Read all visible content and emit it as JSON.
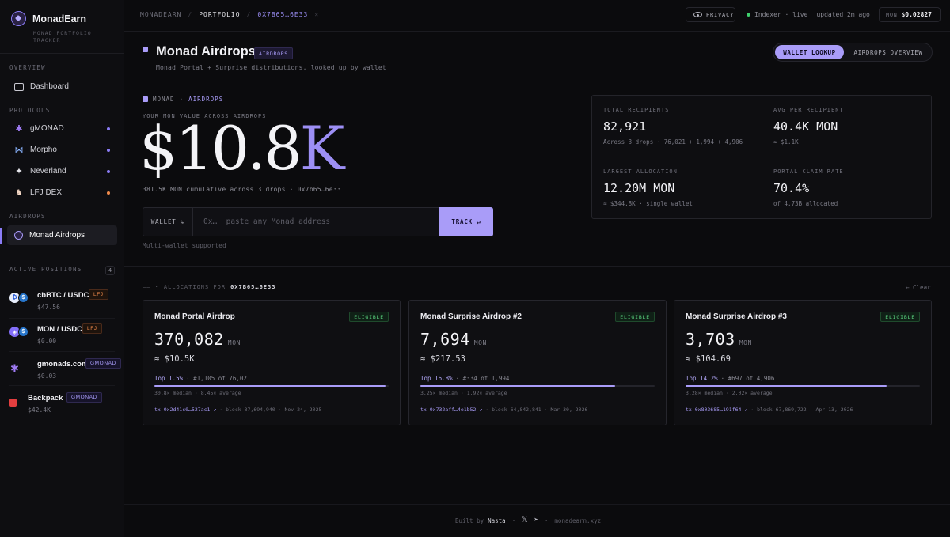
{
  "brand": {
    "name": "MonadEarn",
    "subtitle": "MONAD PORTFOLIO TRACKER"
  },
  "sidebar": {
    "sections": {
      "overview": "OVERVIEW",
      "protocols": "PROTOCOLS",
      "airdrops": "AIRDROPS",
      "active_positions": "ACTIVE POSITIONS"
    },
    "dashboard_label": "Dashboard",
    "protocols": [
      {
        "label": "gMONAD",
        "icon": "gmonad-icon",
        "dot_color": "#8b7cf6"
      },
      {
        "label": "Morpho",
        "icon": "morpho-icon",
        "dot_color": "#8b7cf6"
      },
      {
        "label": "Neverland",
        "icon": "sparkle-icon",
        "dot_color": "#8b7cf6"
      },
      {
        "label": "LFJ DEX",
        "icon": "lfj-icon",
        "dot_color": "#f08a4b"
      }
    ],
    "airdrops_label": "Monad Airdrops",
    "positions_count": "4",
    "positions": [
      {
        "name": "cbBTC / USDC",
        "value": "$47.56",
        "tag": "LFJ"
      },
      {
        "name": "MON / USDC",
        "value": "$0.00",
        "tag": "LFJ"
      },
      {
        "name": "gmonads.com",
        "value": "$0.03",
        "tag": "GMONAD"
      },
      {
        "name": "Backpack",
        "value": "$42.4K",
        "tag": "GMONAD"
      }
    ]
  },
  "topbar": {
    "crumbs": [
      "MONADEARN",
      "PORTFOLIO",
      "0X7B65…6E33"
    ],
    "close": "×",
    "privacy_label": "PRIVACY",
    "indexer_status": "Indexer · live",
    "updated": "updated 2m ago",
    "price_label": "MON",
    "price_value": "$0.02827"
  },
  "page": {
    "title": "Monad Airdrops",
    "badge": "AIRDROPS",
    "subtitle": "Monad Portal + Surprise distributions, looked up by wallet",
    "tabs": [
      "WALLET LOOKUP",
      "AIRDROPS OVERVIEW"
    ]
  },
  "hero": {
    "tag_a": "MONAD",
    "tag_sep": "·",
    "tag_b": "AIRDROPS",
    "label": "YOUR MON VALUE ACROSS AIRDROPS",
    "value_main": "$10.8",
    "value_suffix": "K",
    "sub": "381.5K MON cumulative across 3 drops · 0x7b65…6e33",
    "wallet_label": "WALLET ↳",
    "wallet_placeholder": "0x…  paste any Monad address",
    "track_label": "TRACK ↵",
    "note": "Multi-wallet supported"
  },
  "stats": [
    {
      "label": "TOTAL RECIPIENTS",
      "value": "82,921",
      "sub": "Across 3 drops · 76,021 + 1,994 + 4,906"
    },
    {
      "label": "AVG PER RECIPIENT",
      "value": "40.4K MON",
      "sub": "≈ $1.1K"
    },
    {
      "label": "LARGEST ALLOCATION",
      "value": "12.20M MON",
      "sub": "≈ $344.8K · single wallet"
    },
    {
      "label": "PORTAL CLAIM RATE",
      "value": "70.4%",
      "sub": "of 4.73B allocated"
    }
  ],
  "allocations": {
    "dash": "—— ·",
    "label": "ALLOCATIONS FOR",
    "wallet": "0X7B65…6E33",
    "clear": "← Clear",
    "cards": [
      {
        "title": "Monad Portal Airdrop",
        "badge": "ELIGIBLE",
        "amount": "370,082",
        "unit": "MON",
        "usd": "≈ $10.5K",
        "top": "Top 1.5%",
        "rank": "· #1,105 of 76,021",
        "percentile_fill": 0.985,
        "stats": "30.8× median · 8.45× average",
        "tx": "tx 0x2d41c0…527ac1 ↗",
        "meta": "· block 37,694,940 · Nov 24, 2025"
      },
      {
        "title": "Monad Surprise Airdrop #2",
        "badge": "ELIGIBLE",
        "amount": "7,694",
        "unit": "MON",
        "usd": "≈ $217.53",
        "top": "Top 16.8%",
        "rank": "· #334 of 1,994",
        "percentile_fill": 0.832,
        "stats": "3.25× median · 1.92× average",
        "tx": "tx 0x732aff…4e1b52 ↗",
        "meta": "· block 64,842,841 · Mar 30, 2026"
      },
      {
        "title": "Monad Surprise Airdrop #3",
        "badge": "ELIGIBLE",
        "amount": "3,703",
        "unit": "MON",
        "usd": "≈ $104.69",
        "top": "Top 14.2%",
        "rank": "· #697 of 4,906",
        "percentile_fill": 0.858,
        "stats": "3.28× median · 2.02× average",
        "tx": "tx 0x803685…191f64 ↗",
        "meta": "· block 67,869,722 · Apr 13, 2026"
      }
    ]
  },
  "footer": {
    "built_by": "Built by",
    "author": "Nasta",
    "sep": "·",
    "x_icon": "𝕏",
    "telegram_icon": "➤",
    "domain": "monadearn.xyz"
  },
  "colors": {
    "accent": "#a99cf8",
    "eligible": "#5ad17e",
    "lfj": "#f08a4b",
    "live": "#3ecf6c"
  }
}
